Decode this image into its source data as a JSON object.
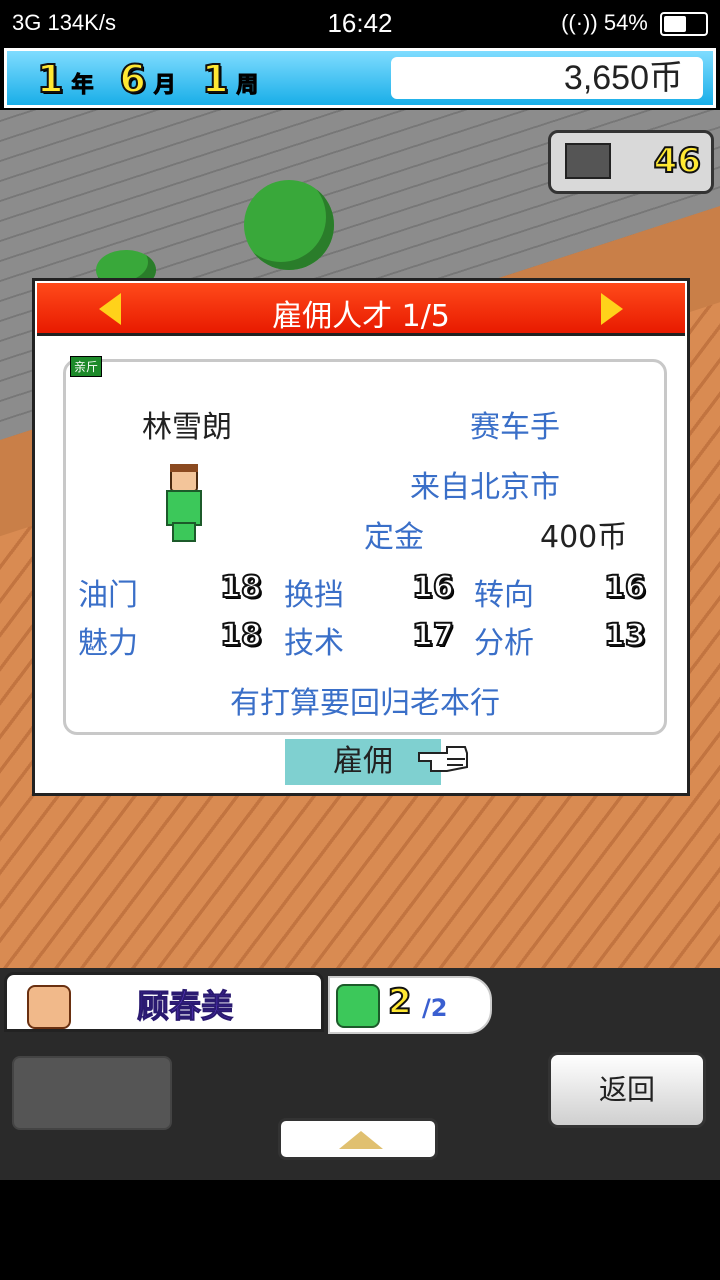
{
  "status_bar": {
    "left": "3G  134K/s",
    "time": "16:42",
    "battery": "54%",
    "battery_level": 0.54
  },
  "top_bar": {
    "year": "1",
    "year_unit": "年",
    "month": "6",
    "month_unit": "月",
    "week": "1",
    "week_unit": "周",
    "money": "3,650币"
  },
  "scene": {
    "counter_value": "46"
  },
  "dialog": {
    "title": "雇佣人才 1/5",
    "tag": "亲斤",
    "name": "林雪朗",
    "job": "赛车手",
    "origin": "来自北京市",
    "deposit_label": "定金",
    "deposit_value": "400币",
    "stats": [
      {
        "label": "油门",
        "value": "18"
      },
      {
        "label": "换挡",
        "value": "16"
      },
      {
        "label": "转向",
        "value": "16"
      },
      {
        "label": "魅力",
        "value": "18"
      },
      {
        "label": "技术",
        "value": "17"
      },
      {
        "label": "分析",
        "value": "13"
      }
    ],
    "note": "有打算要回归老本行",
    "hire_label": "雇佣"
  },
  "bottom": {
    "manager_name": "顾春美",
    "staff_current": "2",
    "staff_total": "/2",
    "back_label": "返回"
  },
  "colors": {
    "dialog_header": "#e81a00",
    "label_blue": "#3a6fc8",
    "hire_button": "#7fd0d0"
  }
}
